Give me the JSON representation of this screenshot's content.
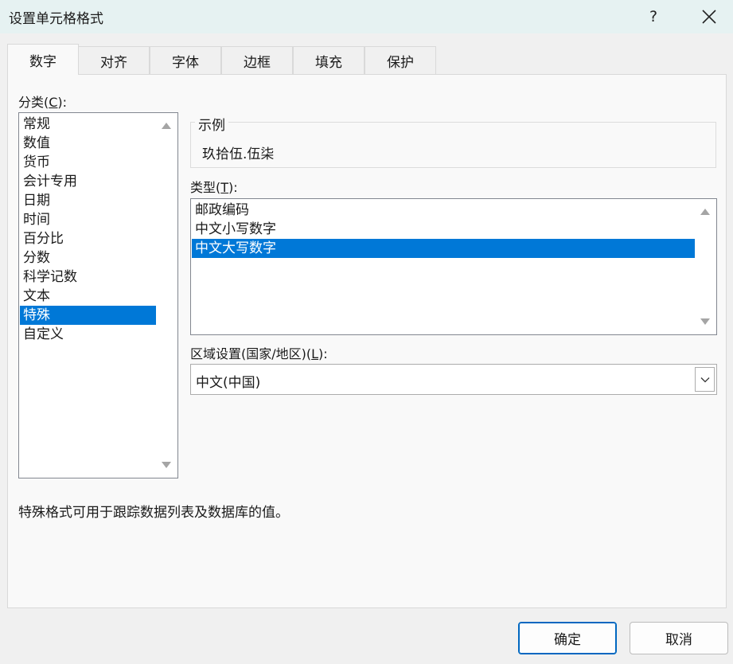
{
  "window": {
    "title": "设置单元格格式",
    "help_label": "?"
  },
  "tabs": [
    {
      "label": "数字",
      "active": true
    },
    {
      "label": "对齐",
      "active": false
    },
    {
      "label": "字体",
      "active": false
    },
    {
      "label": "边框",
      "active": false
    },
    {
      "label": "填充",
      "active": false
    },
    {
      "label": "保护",
      "active": false
    }
  ],
  "category": {
    "label_prefix": "分类(",
    "label_accel": "C",
    "label_suffix": "):",
    "items": [
      "常规",
      "数值",
      "货币",
      "会计专用",
      "日期",
      "时间",
      "百分比",
      "分数",
      "科学记数",
      "文本",
      "特殊",
      "自定义"
    ],
    "selected": "特殊"
  },
  "sample": {
    "legend": "示例",
    "value": "玖拾伍.伍柒"
  },
  "type": {
    "label_prefix": "类型(",
    "label_accel": "T",
    "label_suffix": "):",
    "items": [
      "邮政编码",
      "中文小写数字",
      "中文大写数字"
    ],
    "selected": "中文大写数字"
  },
  "locale": {
    "label_prefix": "区域设置(国家/地区)(",
    "label_accel": "L",
    "label_suffix": "):",
    "value": "中文(中国)"
  },
  "description": "特殊格式可用于跟踪数据列表及数据库的值。",
  "buttons": {
    "ok": "确定",
    "cancel": "取消"
  },
  "colors": {
    "selection": "#0078d7",
    "titlebar": "#e6f2f2",
    "primary_border": "#0067c0"
  }
}
